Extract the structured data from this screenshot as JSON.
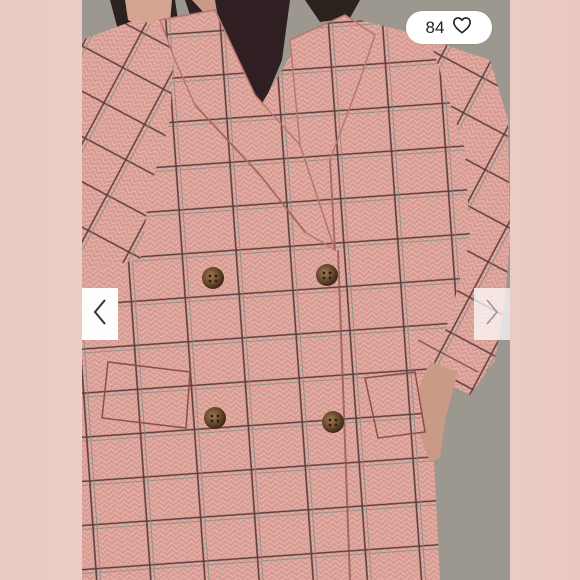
{
  "listing": {
    "like_count": "84",
    "like_icon": "heart-outline-icon",
    "prev_icon": "chevron-left-icon",
    "next_icon": "chevron-right-icon"
  },
  "colors": {
    "coat_pink": "#d79990",
    "plaid_dark": "#5a3f3c",
    "button_tortoise": "#6b4a2f",
    "backdrop_gray": "#9b9790",
    "shirt_dark": "#2f1f22"
  }
}
